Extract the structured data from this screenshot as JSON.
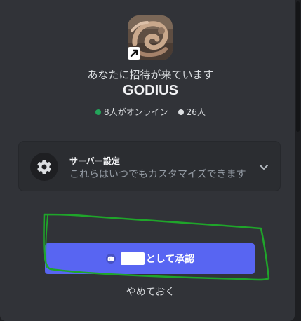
{
  "invite": {
    "title": "あなたに招待が来ています",
    "server_name": "GODIUS",
    "online_text": "8人がオンライン",
    "members_text": "26人"
  },
  "settings": {
    "title": "サーバー設定",
    "subtitle": "これらはいつでもカスタマイズできます"
  },
  "actions": {
    "authorize_suffix": "として承認",
    "cancel_label": "やめておく"
  },
  "icons": {
    "server": "server-avatar",
    "shortcut": "shortcut-arrow-icon",
    "gear": "gear-icon",
    "chevron": "chevron-down-icon",
    "discord": "discord-icon"
  },
  "colors": {
    "background": "#313338",
    "card": "#2b2d31",
    "accent": "#5865f2",
    "online": "#23a55a",
    "annotation": "#1fa52a"
  }
}
